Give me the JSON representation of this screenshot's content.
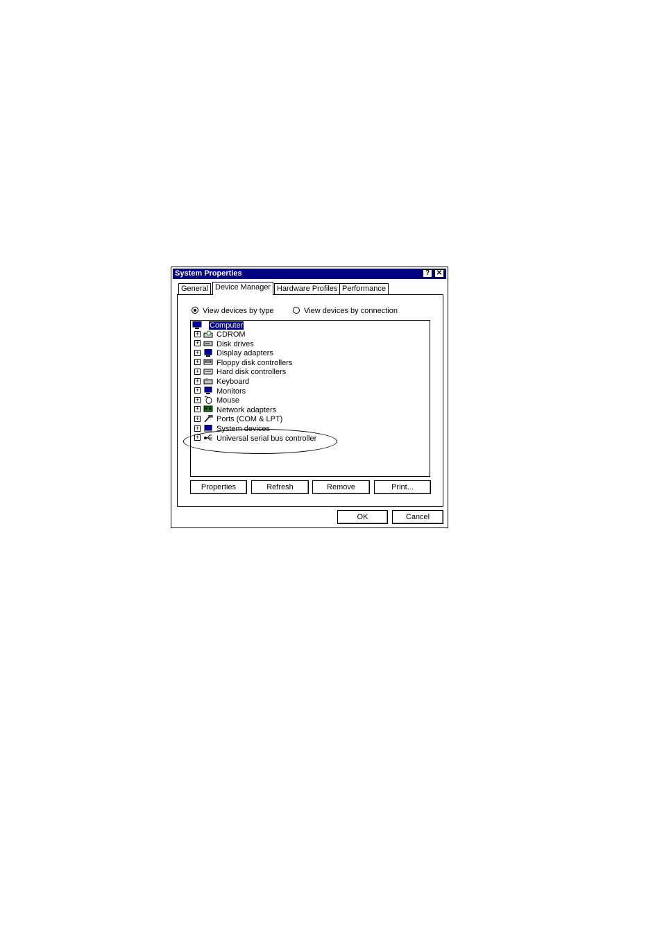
{
  "window": {
    "title": "System Properties",
    "help_label": "?",
    "close_label": "✕"
  },
  "tabs": [
    {
      "label": "General"
    },
    {
      "label": "Device Manager"
    },
    {
      "label": "Hardware Profiles"
    },
    {
      "label": "Performance"
    }
  ],
  "view_options": {
    "by_type": "View devices by type",
    "by_connection": "View devices by connection",
    "selected": "by_type"
  },
  "tree": {
    "root": "Computer",
    "items": [
      {
        "label": "CDROM",
        "icon": "cdrom-icon"
      },
      {
        "label": "Disk drives",
        "icon": "disk-drive-icon"
      },
      {
        "label": "Display adapters",
        "icon": "display-adapter-icon"
      },
      {
        "label": "Floppy disk controllers",
        "icon": "floppy-controller-icon"
      },
      {
        "label": "Hard disk controllers",
        "icon": "hard-disk-controller-icon"
      },
      {
        "label": "Keyboard",
        "icon": "keyboard-icon"
      },
      {
        "label": "Monitors",
        "icon": "monitor-icon"
      },
      {
        "label": "Mouse",
        "icon": "mouse-icon"
      },
      {
        "label": "Network adapters",
        "icon": "network-adapter-icon"
      },
      {
        "label": "Ports (COM & LPT)",
        "icon": "port-icon"
      },
      {
        "label": "System devices",
        "icon": "system-device-icon"
      },
      {
        "label": "Universal serial bus controller",
        "icon": "usb-icon"
      }
    ]
  },
  "buttons": {
    "properties": "Properties",
    "refresh": "Refresh",
    "remove": "Remove",
    "print": "Print...",
    "ok": "OK",
    "cancel": "Cancel"
  }
}
